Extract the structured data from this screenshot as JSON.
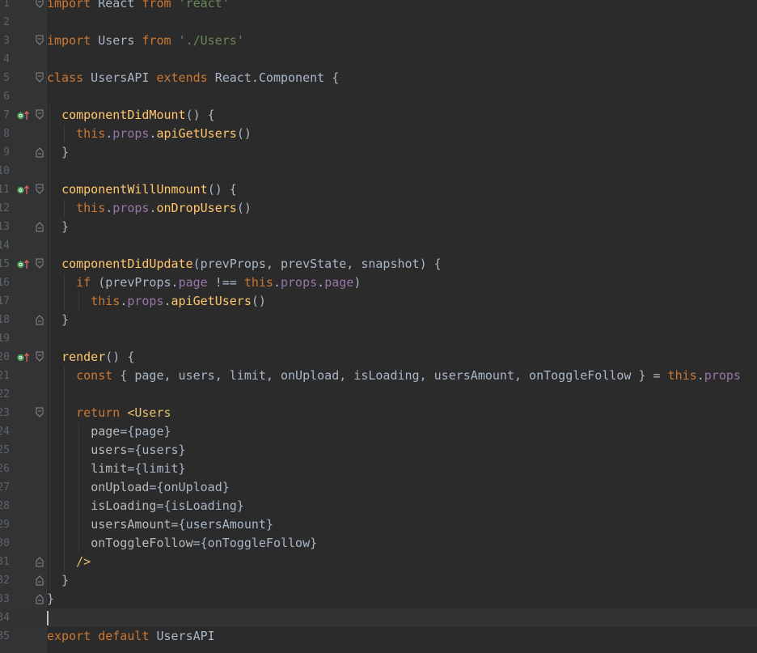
{
  "editor": {
    "language": "javascript",
    "current_line": 34,
    "lines": [
      {
        "n": "1",
        "fold": "open",
        "marker": null,
        "tokens": [
          [
            "kw",
            "import"
          ],
          [
            "plain",
            " React "
          ],
          [
            "kw",
            "from"
          ],
          [
            "plain",
            " "
          ],
          [
            "str",
            "'react'"
          ]
        ]
      },
      {
        "n": "2",
        "fold": null,
        "marker": null,
        "tokens": []
      },
      {
        "n": "3",
        "fold": "open",
        "marker": null,
        "tokens": [
          [
            "kw",
            "import"
          ],
          [
            "plain",
            " Users "
          ],
          [
            "kw",
            "from"
          ],
          [
            "plain",
            " "
          ],
          [
            "str",
            "'./Users'"
          ]
        ]
      },
      {
        "n": "4",
        "fold": null,
        "marker": null,
        "tokens": []
      },
      {
        "n": "5",
        "fold": "open",
        "marker": null,
        "tokens": [
          [
            "kw",
            "class"
          ],
          [
            "plain",
            " UsersAPI "
          ],
          [
            "kw",
            "extends"
          ],
          [
            "plain",
            " React.Component {"
          ]
        ]
      },
      {
        "n": "6",
        "fold": null,
        "marker": null,
        "tokens": []
      },
      {
        "n": "7",
        "fold": "open",
        "marker": "override",
        "tokens": [
          [
            "plain",
            "  "
          ],
          [
            "fn",
            "componentDidMount"
          ],
          [
            "plain",
            "() {"
          ]
        ]
      },
      {
        "n": "8",
        "fold": null,
        "marker": null,
        "tokens": [
          [
            "plain",
            "    "
          ],
          [
            "kw",
            "this"
          ],
          [
            "plain",
            "."
          ],
          [
            "prop",
            "props"
          ],
          [
            "plain",
            "."
          ],
          [
            "fn",
            "apiGetUsers"
          ],
          [
            "plain",
            "()"
          ]
        ]
      },
      {
        "n": "9",
        "fold": "close",
        "marker": null,
        "tokens": [
          [
            "plain",
            "  }"
          ]
        ]
      },
      {
        "n": "10",
        "fold": null,
        "marker": null,
        "tokens": []
      },
      {
        "n": "11",
        "fold": "open",
        "marker": "override",
        "tokens": [
          [
            "plain",
            "  "
          ],
          [
            "fn",
            "componentWillUnmount"
          ],
          [
            "plain",
            "() {"
          ]
        ]
      },
      {
        "n": "12",
        "fold": null,
        "marker": null,
        "tokens": [
          [
            "plain",
            "    "
          ],
          [
            "kw",
            "this"
          ],
          [
            "plain",
            "."
          ],
          [
            "prop",
            "props"
          ],
          [
            "plain",
            "."
          ],
          [
            "fn",
            "onDropUsers"
          ],
          [
            "plain",
            "()"
          ]
        ]
      },
      {
        "n": "13",
        "fold": "close",
        "marker": null,
        "tokens": [
          [
            "plain",
            "  }"
          ]
        ]
      },
      {
        "n": "14",
        "fold": null,
        "marker": null,
        "tokens": []
      },
      {
        "n": "15",
        "fold": "open",
        "marker": "override",
        "tokens": [
          [
            "plain",
            "  "
          ],
          [
            "fn",
            "componentDidUpdate"
          ],
          [
            "plain",
            "(prevProps, prevState, snapshot) {"
          ]
        ]
      },
      {
        "n": "16",
        "fold": null,
        "marker": null,
        "tokens": [
          [
            "plain",
            "    "
          ],
          [
            "kw",
            "if"
          ],
          [
            "plain",
            " (prevProps."
          ],
          [
            "prop",
            "page"
          ],
          [
            "plain",
            " !== "
          ],
          [
            "kw",
            "this"
          ],
          [
            "plain",
            "."
          ],
          [
            "prop",
            "props"
          ],
          [
            "plain",
            "."
          ],
          [
            "prop",
            "page"
          ],
          [
            "plain",
            ")"
          ]
        ]
      },
      {
        "n": "17",
        "fold": null,
        "marker": null,
        "tokens": [
          [
            "plain",
            "      "
          ],
          [
            "kw",
            "this"
          ],
          [
            "plain",
            "."
          ],
          [
            "prop",
            "props"
          ],
          [
            "plain",
            "."
          ],
          [
            "fn",
            "apiGetUsers"
          ],
          [
            "plain",
            "()"
          ]
        ]
      },
      {
        "n": "18",
        "fold": "close",
        "marker": null,
        "tokens": [
          [
            "plain",
            "  }"
          ]
        ]
      },
      {
        "n": "19",
        "fold": null,
        "marker": null,
        "tokens": []
      },
      {
        "n": "20",
        "fold": "open",
        "marker": "override",
        "tokens": [
          [
            "plain",
            "  "
          ],
          [
            "fn",
            "render"
          ],
          [
            "plain",
            "() {"
          ]
        ]
      },
      {
        "n": "21",
        "fold": null,
        "marker": null,
        "tokens": [
          [
            "plain",
            "    "
          ],
          [
            "kw",
            "const"
          ],
          [
            "plain",
            " { page, users, limit, onUpload, isLoading, usersAmount, onToggleFollow } = "
          ],
          [
            "kw",
            "this"
          ],
          [
            "plain",
            "."
          ],
          [
            "prop",
            "props"
          ]
        ]
      },
      {
        "n": "22",
        "fold": null,
        "marker": null,
        "tokens": []
      },
      {
        "n": "23",
        "fold": "open",
        "marker": null,
        "tokens": [
          [
            "plain",
            "    "
          ],
          [
            "kw",
            "return"
          ],
          [
            "plain",
            " "
          ],
          [
            "tag",
            "<Users"
          ]
        ]
      },
      {
        "n": "24",
        "fold": null,
        "marker": null,
        "tokens": [
          [
            "plain",
            "      "
          ],
          [
            "attr",
            "page"
          ],
          [
            "plain",
            "={page}"
          ]
        ]
      },
      {
        "n": "25",
        "fold": null,
        "marker": null,
        "tokens": [
          [
            "plain",
            "      "
          ],
          [
            "attr",
            "users"
          ],
          [
            "plain",
            "={users}"
          ]
        ]
      },
      {
        "n": "26",
        "fold": null,
        "marker": null,
        "tokens": [
          [
            "plain",
            "      "
          ],
          [
            "attr",
            "limit"
          ],
          [
            "plain",
            "={limit}"
          ]
        ]
      },
      {
        "n": "27",
        "fold": null,
        "marker": null,
        "tokens": [
          [
            "plain",
            "      "
          ],
          [
            "attr",
            "onUpload"
          ],
          [
            "plain",
            "={onUpload}"
          ]
        ]
      },
      {
        "n": "28",
        "fold": null,
        "marker": null,
        "tokens": [
          [
            "plain",
            "      "
          ],
          [
            "attr",
            "isLoading"
          ],
          [
            "plain",
            "={isLoading}"
          ]
        ]
      },
      {
        "n": "29",
        "fold": null,
        "marker": null,
        "tokens": [
          [
            "plain",
            "      "
          ],
          [
            "attr",
            "usersAmount"
          ],
          [
            "plain",
            "={usersAmount}"
          ]
        ]
      },
      {
        "n": "30",
        "fold": null,
        "marker": null,
        "tokens": [
          [
            "plain",
            "      "
          ],
          [
            "attr",
            "onToggleFollow"
          ],
          [
            "plain",
            "={onToggleFollow}"
          ]
        ]
      },
      {
        "n": "31",
        "fold": "close",
        "marker": null,
        "tokens": [
          [
            "plain",
            "    "
          ],
          [
            "tag",
            "/>"
          ]
        ]
      },
      {
        "n": "32",
        "fold": "close",
        "marker": null,
        "tokens": [
          [
            "plain",
            "  }"
          ]
        ]
      },
      {
        "n": "33",
        "fold": "close",
        "marker": null,
        "tokens": [
          [
            "plain",
            "}"
          ]
        ]
      },
      {
        "n": "34",
        "fold": null,
        "marker": null,
        "tokens": []
      },
      {
        "n": "35",
        "fold": null,
        "marker": null,
        "tokens": [
          [
            "kw",
            "export"
          ],
          [
            "plain",
            " "
          ],
          [
            "kw",
            "default"
          ],
          [
            "plain",
            " UsersAPI"
          ]
        ]
      }
    ]
  },
  "colors": {
    "background": "#2b2b2b",
    "gutter": "#313335",
    "keyword": "#cc7832",
    "string": "#6a8759",
    "function": "#ffc66d",
    "property": "#9876aa",
    "plain": "#a9b7c6",
    "line_number": "#606366",
    "override_marker_circle": "#499c54",
    "override_marker_arrow": "#d75f5f"
  },
  "icons": {
    "override_marker": "override-method-icon",
    "fold_open": "fold-open-icon",
    "fold_close": "fold-close-icon"
  }
}
